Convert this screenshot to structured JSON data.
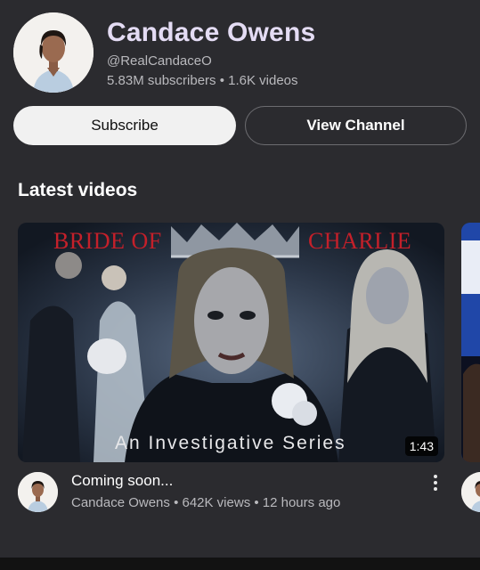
{
  "channel": {
    "name": "Candace Owens",
    "handle": "@RealCandaceO",
    "stats": "5.83M subscribers • 1.6K videos"
  },
  "buttons": {
    "subscribe": "Subscribe",
    "view_channel": "View Channel"
  },
  "section": {
    "title": "Latest videos"
  },
  "video": {
    "thumbnail_title_left": "BRIDE OF",
    "thumbnail_title_right": "CHARLIE",
    "thumbnail_subtitle": "An Investigative Series",
    "duration": "1:43",
    "title": "Coming soon...",
    "meta": "Candace Owens • 642K views • 12 hours ago"
  },
  "colors": {
    "background": "#2b2b2f",
    "channel_name": "#e4dcf4",
    "thumbnail_title": "#c4202a"
  }
}
